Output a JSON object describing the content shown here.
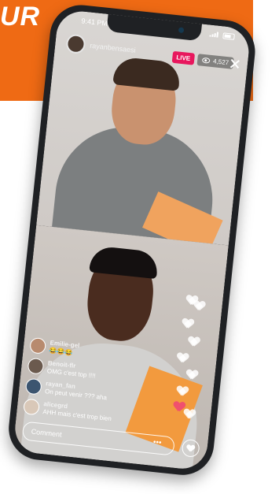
{
  "banner": {
    "text": "UR",
    "color": "#ef6a14"
  },
  "status": {
    "time": "9:41 PM"
  },
  "live": {
    "host_name": "rayanbensaesi",
    "badge": "LIVE",
    "viewers": "4,527",
    "badge_color": "#e8175d"
  },
  "comments": [
    {
      "user": "Emilie-gel",
      "text": "😂😂😂"
    },
    {
      "user": "Benoit-flr",
      "text": "OMG c'est top !!!!"
    },
    {
      "user": "rayan_fan",
      "text": "On peut venir ??? aha"
    },
    {
      "user": "alicegrd",
      "text": "AHH mais c'est trop bien"
    }
  ],
  "input": {
    "placeholder": "Comment"
  },
  "icons": [
    "close-icon",
    "eye-icon",
    "heart-icon",
    "more-icon"
  ]
}
